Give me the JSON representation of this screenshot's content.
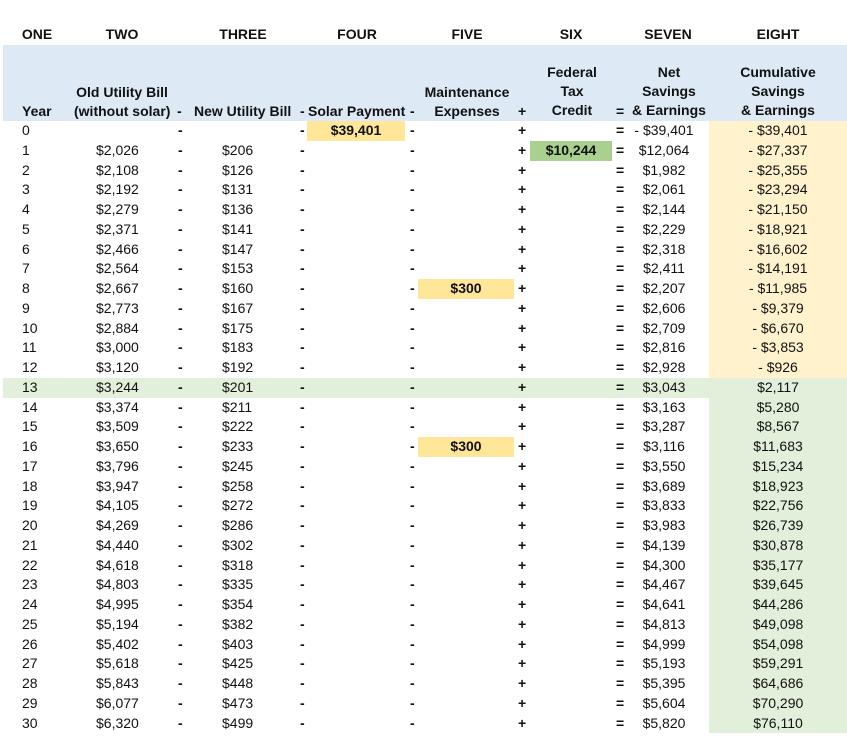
{
  "column_letters": [
    "ONE",
    "TWO",
    "THREE",
    "FOUR",
    "FIVE",
    "SIX",
    "SEVEN",
    "EIGHT"
  ],
  "headers": {
    "year": "Year",
    "old_bill": [
      "Old Utility Bill",
      "(without solar)"
    ],
    "new_bill": "New Utility Bill",
    "solar_payment": "Solar Payment",
    "maintenance": [
      "Maintenance",
      "Expenses"
    ],
    "tax_credit": [
      "Federal",
      "Tax",
      "Credit"
    ],
    "net": [
      "Net",
      "Savings",
      "& Earnings"
    ],
    "cumulative": [
      "Cumulative",
      "Savings",
      "& Earnings"
    ],
    "operators": {
      "minus": "-",
      "plus": "+",
      "equals": "="
    }
  },
  "colors": {
    "header_band": "#dde9f5",
    "highlight_yellow": "#ffe699",
    "highlight_green": "#a9d08e",
    "cumulative_negative": "#fff2cc",
    "cumulative_positive": "#e2efda"
  },
  "breakeven_year": 13,
  "rows": [
    {
      "year": "0",
      "old": "",
      "new": "",
      "solar": "$39,401",
      "maint": "",
      "tax": "",
      "net": "- $39,401",
      "cum": "- $39,401"
    },
    {
      "year": "1",
      "old": "$2,026",
      "new": "$206",
      "solar": "",
      "maint": "",
      "tax": "$10,244",
      "net": "$12,064",
      "cum": "- $27,337"
    },
    {
      "year": "2",
      "old": "$2,108",
      "new": "$126",
      "solar": "",
      "maint": "",
      "tax": "",
      "net": "$1,982",
      "cum": "- $25,355"
    },
    {
      "year": "3",
      "old": "$2,192",
      "new": "$131",
      "solar": "",
      "maint": "",
      "tax": "",
      "net": "$2,061",
      "cum": "- $23,294"
    },
    {
      "year": "4",
      "old": "$2,279",
      "new": "$136",
      "solar": "",
      "maint": "",
      "tax": "",
      "net": "$2,144",
      "cum": "- $21,150"
    },
    {
      "year": "5",
      "old": "$2,371",
      "new": "$141",
      "solar": "",
      "maint": "",
      "tax": "",
      "net": "$2,229",
      "cum": "- $18,921"
    },
    {
      "year": "6",
      "old": "$2,466",
      "new": "$147",
      "solar": "",
      "maint": "",
      "tax": "",
      "net": "$2,318",
      "cum": "- $16,602"
    },
    {
      "year": "7",
      "old": "$2,564",
      "new": "$153",
      "solar": "",
      "maint": "",
      "tax": "",
      "net": "$2,411",
      "cum": "- $14,191"
    },
    {
      "year": "8",
      "old": "$2,667",
      "new": "$160",
      "solar": "",
      "maint": "$300",
      "tax": "",
      "net": "$2,207",
      "cum": "- $11,985"
    },
    {
      "year": "9",
      "old": "$2,773",
      "new": "$167",
      "solar": "",
      "maint": "",
      "tax": "",
      "net": "$2,606",
      "cum": "- $9,379"
    },
    {
      "year": "10",
      "old": "$2,884",
      "new": "$175",
      "solar": "",
      "maint": "",
      "tax": "",
      "net": "$2,709",
      "cum": "- $6,670"
    },
    {
      "year": "11",
      "old": "$3,000",
      "new": "$183",
      "solar": "",
      "maint": "",
      "tax": "",
      "net": "$2,816",
      "cum": "- $3,853"
    },
    {
      "year": "12",
      "old": "$3,120",
      "new": "$192",
      "solar": "",
      "maint": "",
      "tax": "",
      "net": "$2,928",
      "cum": "- $926"
    },
    {
      "year": "13",
      "old": "$3,244",
      "new": "$201",
      "solar": "",
      "maint": "",
      "tax": "",
      "net": "$3,043",
      "cum": "$2,117"
    },
    {
      "year": "14",
      "old": "$3,374",
      "new": "$211",
      "solar": "",
      "maint": "",
      "tax": "",
      "net": "$3,163",
      "cum": "$5,280"
    },
    {
      "year": "15",
      "old": "$3,509",
      "new": "$222",
      "solar": "",
      "maint": "",
      "tax": "",
      "net": "$3,287",
      "cum": "$8,567"
    },
    {
      "year": "16",
      "old": "$3,650",
      "new": "$233",
      "solar": "",
      "maint": "$300",
      "tax": "",
      "net": "$3,116",
      "cum": "$11,683"
    },
    {
      "year": "17",
      "old": "$3,796",
      "new": "$245",
      "solar": "",
      "maint": "",
      "tax": "",
      "net": "$3,550",
      "cum": "$15,234"
    },
    {
      "year": "18",
      "old": "$3,947",
      "new": "$258",
      "solar": "",
      "maint": "",
      "tax": "",
      "net": "$3,689",
      "cum": "$18,923"
    },
    {
      "year": "19",
      "old": "$4,105",
      "new": "$272",
      "solar": "",
      "maint": "",
      "tax": "",
      "net": "$3,833",
      "cum": "$22,756"
    },
    {
      "year": "20",
      "old": "$4,269",
      "new": "$286",
      "solar": "",
      "maint": "",
      "tax": "",
      "net": "$3,983",
      "cum": "$26,739"
    },
    {
      "year": "21",
      "old": "$4,440",
      "new": "$302",
      "solar": "",
      "maint": "",
      "tax": "",
      "net": "$4,139",
      "cum": "$30,878"
    },
    {
      "year": "22",
      "old": "$4,618",
      "new": "$318",
      "solar": "",
      "maint": "",
      "tax": "",
      "net": "$4,300",
      "cum": "$35,177"
    },
    {
      "year": "23",
      "old": "$4,803",
      "new": "$335",
      "solar": "",
      "maint": "",
      "tax": "",
      "net": "$4,467",
      "cum": "$39,645"
    },
    {
      "year": "24",
      "old": "$4,995",
      "new": "$354",
      "solar": "",
      "maint": "",
      "tax": "",
      "net": "$4,641",
      "cum": "$44,286"
    },
    {
      "year": "25",
      "old": "$5,194",
      "new": "$382",
      "solar": "",
      "maint": "",
      "tax": "",
      "net": "$4,813",
      "cum": "$49,098"
    },
    {
      "year": "26",
      "old": "$5,402",
      "new": "$403",
      "solar": "",
      "maint": "",
      "tax": "",
      "net": "$4,999",
      "cum": "$54,098"
    },
    {
      "year": "27",
      "old": "$5,618",
      "new": "$425",
      "solar": "",
      "maint": "",
      "tax": "",
      "net": "$5,193",
      "cum": "$59,291"
    },
    {
      "year": "28",
      "old": "$5,843",
      "new": "$448",
      "solar": "",
      "maint": "",
      "tax": "",
      "net": "$5,395",
      "cum": "$64,686"
    },
    {
      "year": "29",
      "old": "$6,077",
      "new": "$473",
      "solar": "",
      "maint": "",
      "tax": "",
      "net": "$5,604",
      "cum": "$70,290"
    },
    {
      "year": "30",
      "old": "$6,320",
      "new": "$499",
      "solar": "",
      "maint": "",
      "tax": "",
      "net": "$5,820",
      "cum": "$76,110"
    }
  ]
}
